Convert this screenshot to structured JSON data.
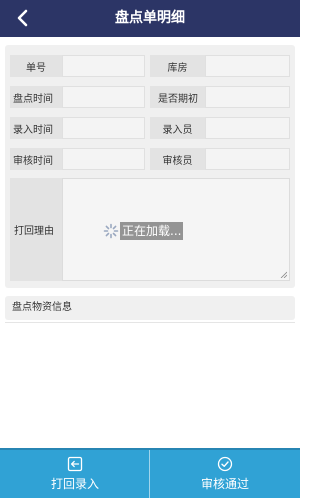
{
  "header": {
    "title": "盘点单明细"
  },
  "form": {
    "rows": [
      {
        "label_left": "单号",
        "value_left": "",
        "label_right": "库房",
        "value_right": ""
      },
      {
        "label_left": "盘点时间",
        "value_left": "",
        "label_right": "是否期初",
        "value_right": ""
      },
      {
        "label_left": "录入时间",
        "value_left": "",
        "label_right": "录入员",
        "value_right": ""
      },
      {
        "label_left": "审核时间",
        "value_left": "",
        "label_right": "审核员",
        "value_right": ""
      }
    ],
    "reject_reason_label": "打回理由",
    "reject_reason_value": ""
  },
  "loading": {
    "text": "正在加载..."
  },
  "section": {
    "title": "盘点物资信息"
  },
  "bottom": {
    "reject_label": "打回录入",
    "approve_label": "审核通过"
  },
  "colors": {
    "header_bg": "#2c3566",
    "bottom_bg": "#30a2d5",
    "card_bg": "#f0f0f0"
  }
}
